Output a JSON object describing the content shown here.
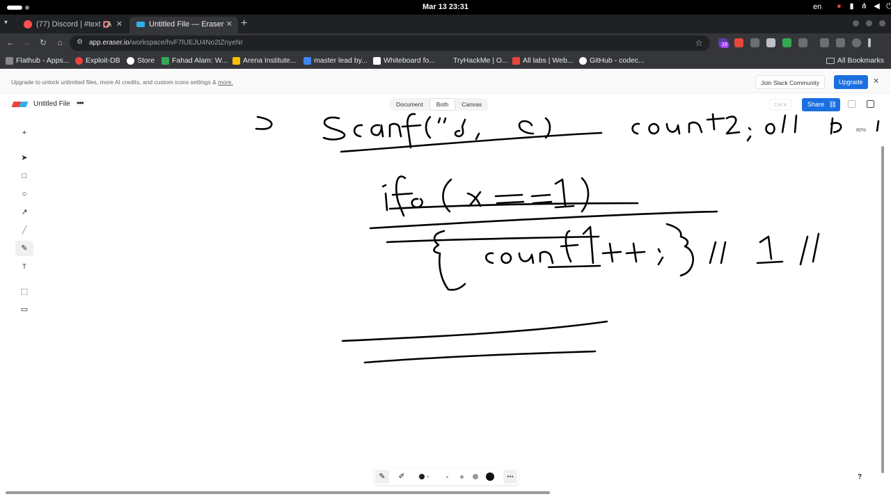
{
  "os": {
    "clock": "Mar 13  23:31",
    "lang": "en"
  },
  "browser": {
    "tabs": [
      {
        "title": "(77) Discord | #text | A",
        "active": false,
        "favicon_color": "#ff4f4f"
      },
      {
        "title": "Untitled File — Eraser",
        "active": true,
        "favicon_color": "#2db1e8"
      }
    ],
    "new_tab": "+",
    "url_host": "app.eraser.io",
    "url_path": "/workspace/hvF7lUEJU4No2tZnyeNr",
    "ext_badge": "16",
    "bookmarks": [
      {
        "label": "Flathub - Apps...",
        "color": "#888888"
      },
      {
        "label": "Exploit-DB",
        "color": "#e8453c"
      },
      {
        "label": "Store",
        "color": "#ffffff"
      },
      {
        "label": "Fahad Alam: W...",
        "color": "#34a853"
      },
      {
        "label": "Arena Institute...",
        "color": "#fbbc04"
      },
      {
        "label": "master lead by...",
        "color": "#4285f4"
      },
      {
        "label": "Whiteboard fo...",
        "color": "#ffffff"
      },
      {
        "label": "TryHackMe | O...",
        "color": "#c41e3a"
      },
      {
        "label": "All labs | Web...",
        "color": "#e8453c"
      },
      {
        "label": "GitHub - codec...",
        "color": "#ffffff"
      }
    ],
    "all_bookmarks": "All Bookmarks"
  },
  "banner": {
    "message": "Upgrade to unlock unlimited files, more AI credits, and custom icons settings & ",
    "more_link": "more.",
    "join_slack": "Join Slack Community",
    "upgrade": "Upgrade"
  },
  "header": {
    "file_title": "Untitled File",
    "menu": "•••",
    "views": [
      "Document",
      "Both",
      "Canvas"
    ],
    "selected_view": "Both",
    "shortcut": "Ctrl K",
    "share": "Share"
  },
  "tools": [
    "+",
    "select",
    "rectangle",
    "ellipse",
    "arrow",
    "line",
    "pen",
    "text",
    "frame",
    "comment"
  ],
  "zoom": "80%",
  "help": "?",
  "colors": {
    "accent": "#1b6fe0",
    "ink": "#000000"
  }
}
